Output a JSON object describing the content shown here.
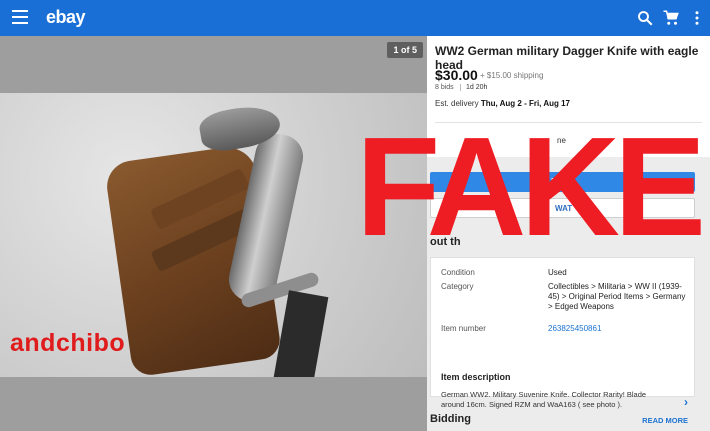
{
  "header": {
    "logo": "ebay",
    "brand_color": "#1a6fd6",
    "icons": [
      "menu-icon",
      "search-icon",
      "cart-icon",
      "more-vert-icon"
    ]
  },
  "media": {
    "counter": "1 of 5",
    "watermark": "andchibo"
  },
  "listing": {
    "title": "WW2 German military Dagger Knife with eagle head",
    "price": "$30.00",
    "shipping": "+ $15.00 shipping",
    "bids": "8 bids",
    "time_left": "1d 20h",
    "delivery_label": "Est. delivery",
    "delivery_dates": "Thu, Aug 2 - Fri, Aug 17",
    "partial_shipping_text": "ne",
    "buttons": {
      "primary_partial": "PLAC",
      "secondary_partial": "WAT"
    },
    "about_partial": "out th"
  },
  "specs": [
    {
      "label": "Condition",
      "value": "Used"
    },
    {
      "label": "Category",
      "value": "Collectibles > Militaria > WW II (1939-45) > Original Period Items > Germany > Edged Weapons"
    },
    {
      "label": "Item number",
      "value": "263825450861"
    }
  ],
  "description": {
    "heading": "Item description",
    "text": "German WW2. Military Suvenire Knife. Collector Rarity! Blade around 16cm. Signed RZM and WaA163 ( see photo ).",
    "read_more": "READ MORE"
  },
  "bidding_heading": "Bidding",
  "overlay": {
    "text": "FAKE",
    "color": "#ee1d23"
  }
}
